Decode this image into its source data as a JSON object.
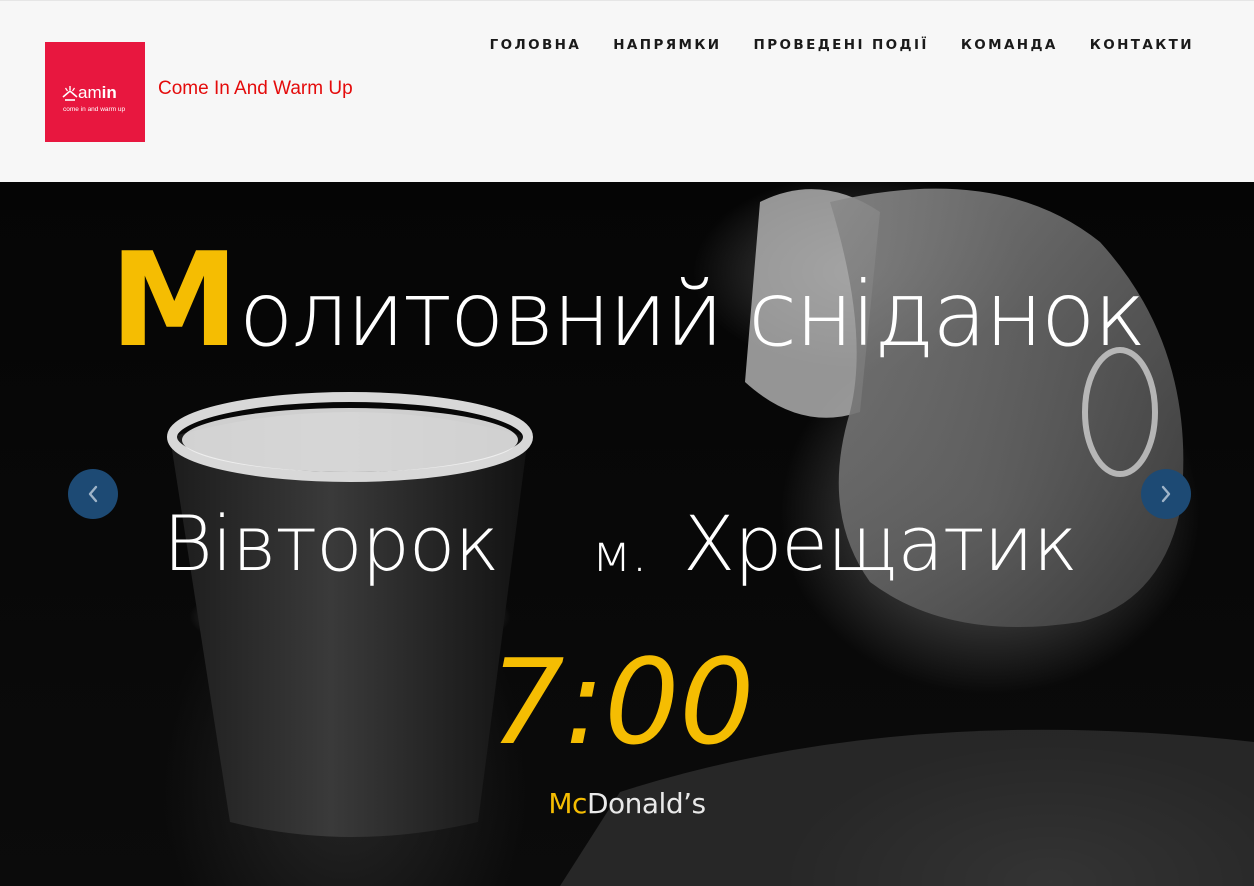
{
  "header": {
    "logo": {
      "mark_prefix": "am",
      "mark_suffix": "in",
      "tagline": "come in and warm up"
    },
    "site_title": "Come In And Warm Up",
    "nav": [
      {
        "label": "ГОЛОВНА"
      },
      {
        "label": "НАПРЯМКИ"
      },
      {
        "label": "ПРОВЕДЕНІ ПОДІЇ"
      },
      {
        "label": "КОМАНДА"
      },
      {
        "label": "КОНТАКТИ"
      }
    ]
  },
  "colors": {
    "brand_red": "#e8173f",
    "title_red": "#e40b0b",
    "accent_yellow": "#f5bd02",
    "arrow_blue": "#1d4a74"
  },
  "hero": {
    "title_initial": "М",
    "title_rest": "олитовний сніданок",
    "day": "Вівторок",
    "location_prefix": "м.",
    "location_name": "Хрещатик",
    "time": "7:00",
    "venue_initial": "Mc",
    "venue_rest": "Donald’s",
    "prev_icon": "chevron-left-icon",
    "next_icon": "chevron-right-icon"
  }
}
